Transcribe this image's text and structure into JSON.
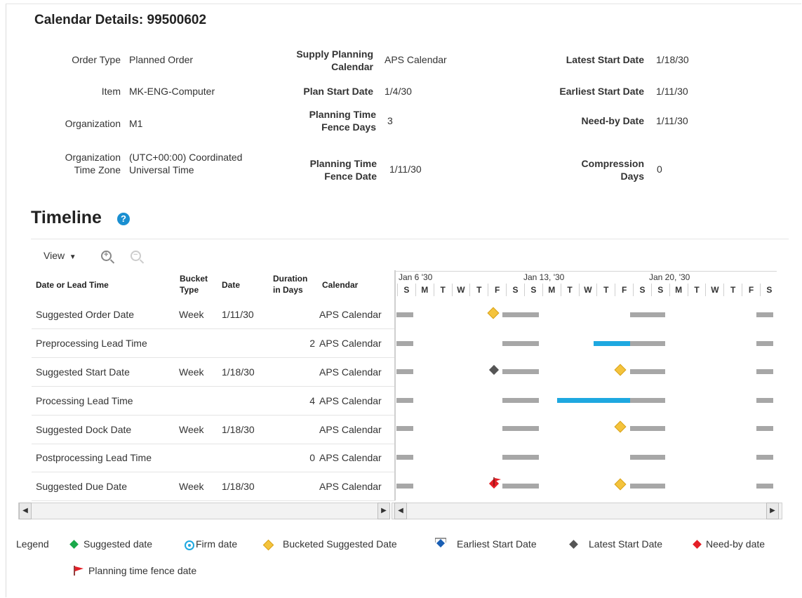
{
  "calendar": {
    "title": "Calendar Details: 99500602",
    "fields": {
      "order_type_label": "Order Type",
      "order_type": "Planned Order",
      "item_label": "Item",
      "item": "MK-ENG-Computer",
      "organization_label": "Organization",
      "organization": "M1",
      "org_tz_label_1": "Organization",
      "org_tz_label_2": "Time Zone",
      "org_tz_1": "(UTC+00:00) Coordinated",
      "org_tz_2": "Universal Time",
      "supply_cal_label_1": "Supply Planning",
      "supply_cal_label_2": "Calendar",
      "supply_cal": "APS Calendar",
      "plan_start_label": "Plan Start Date",
      "plan_start": "1/4/30",
      "ptf_days_label_1": "Planning Time",
      "ptf_days_label_2": "Fence Days",
      "ptf_days": "3",
      "ptf_date_label_1": "Planning Time",
      "ptf_date_label_2": "Fence Date",
      "ptf_date": "1/11/30",
      "latest_start_label": "Latest Start Date",
      "latest_start": "1/18/30",
      "earliest_start_label": "Earliest Start Date",
      "earliest_start": "1/11/30",
      "need_by_label": "Need-by Date",
      "need_by": "1/11/30",
      "compression_label_1": "Compression",
      "compression_label_2": "Days",
      "compression": "0"
    }
  },
  "timeline": {
    "title": "Timeline",
    "help_glyph": "?",
    "view_label": "View",
    "columns": {
      "c1": "Date or Lead Time",
      "c2a": "Bucket",
      "c2b": "Type",
      "c3": "Date",
      "c4a": "Duration",
      "c4b": "in Days",
      "c5": "Calendar"
    },
    "rows": [
      {
        "name": "Suggested Order Date",
        "bucket": "Week",
        "date": "1/11/30",
        "duration": "",
        "calendar": "APS Calendar"
      },
      {
        "name": "Preprocessing Lead Time",
        "bucket": "",
        "date": "",
        "duration": "2",
        "calendar": "APS Calendar"
      },
      {
        "name": "Suggested Start Date",
        "bucket": "Week",
        "date": "1/18/30",
        "duration": "",
        "calendar": "APS Calendar"
      },
      {
        "name": "Processing Lead Time",
        "bucket": "",
        "date": "",
        "duration": "4",
        "calendar": "APS Calendar"
      },
      {
        "name": "Suggested Dock Date",
        "bucket": "Week",
        "date": "1/18/30",
        "duration": "",
        "calendar": "APS Calendar"
      },
      {
        "name": "Postprocessing Lead Time",
        "bucket": "",
        "date": "",
        "duration": "0",
        "calendar": "APS Calendar"
      },
      {
        "name": "Suggested Due Date",
        "bucket": "Week",
        "date": "1/18/30",
        "duration": "",
        "calendar": "APS Calendar"
      }
    ],
    "weeks": [
      "Jan 6 '30",
      "Jan 13, '30",
      "Jan 20, '30"
    ],
    "days": [
      "S",
      "M",
      "T",
      "W",
      "T",
      "F",
      "S",
      "S",
      "M",
      "T",
      "W",
      "T",
      "F",
      "S",
      "S",
      "M",
      "T",
      "W",
      "T",
      "F",
      "S"
    ]
  },
  "legend": {
    "title": "Legend",
    "suggested": "Suggested date",
    "firm": "Firm date",
    "bucketed": "Bucketed Suggested Date",
    "earliest": "Earliest Start Date",
    "latest": "Latest Start Date",
    "need_by": "Need-by date",
    "ptf": "Planning time fence date"
  },
  "colors": {
    "suggested": "#1aa94a",
    "firm": "#1ea8e0",
    "bucketed": "#f4c33c",
    "earliest": "#1a5fb4",
    "latest": "#555555",
    "need_by": "#e41e26",
    "lead_time_bar": "#1ea8e0",
    "nonworking_bar": "#a7a7a7"
  }
}
